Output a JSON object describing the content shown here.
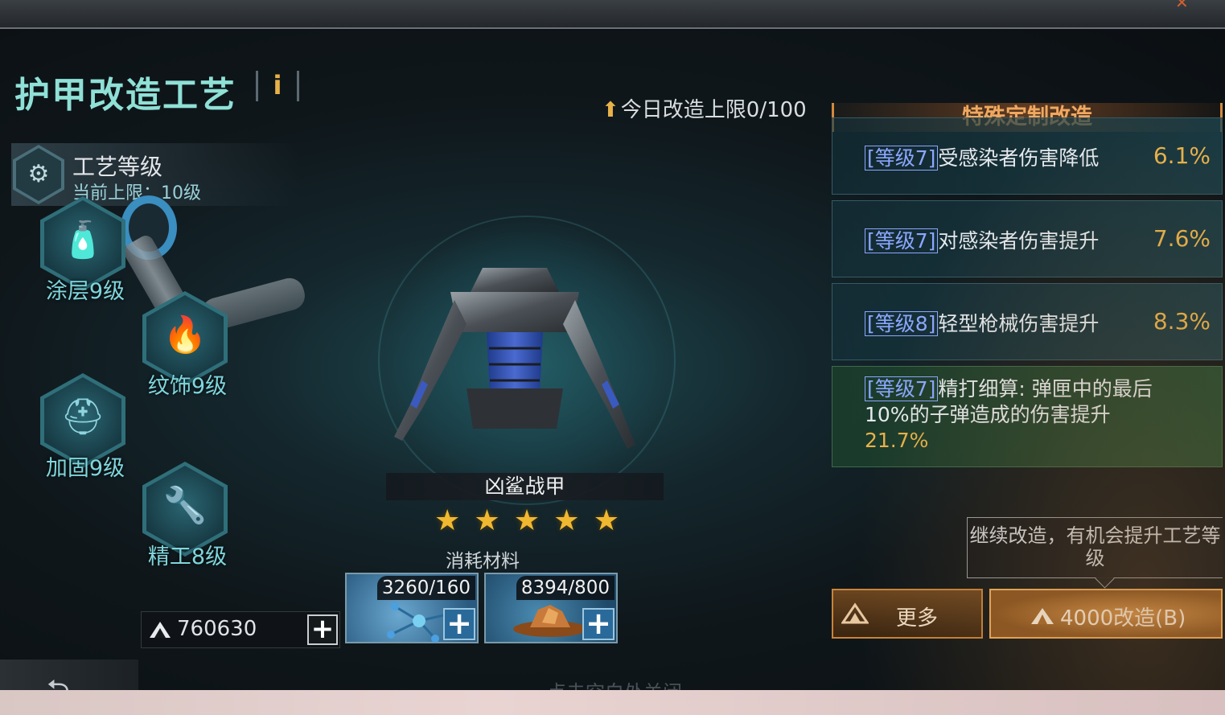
{
  "header": {
    "title": "护甲改造工艺",
    "info_label": "i",
    "daily_limit": "今日改造上限0/100"
  },
  "craft_level": {
    "title": "工艺等级",
    "subtitle": "当前上限：10级"
  },
  "skills": [
    {
      "label": "涂层9级",
      "icon": "spray-can-icon"
    },
    {
      "label": "纹饰9级",
      "icon": "flame-icon"
    },
    {
      "label": "加固9级",
      "icon": "welding-mask-icon"
    },
    {
      "label": "精工8级",
      "icon": "drill-icon"
    }
  ],
  "item": {
    "name": "凶鲨战甲",
    "stars": 5
  },
  "materials": {
    "label": "消耗材料",
    "items": [
      {
        "count": "3260/160",
        "icon": "molecule-icon"
      },
      {
        "count": "8394/800",
        "icon": "ore-icon"
      }
    ]
  },
  "currency": {
    "amount": "760630",
    "icon": "resource-icon"
  },
  "close_hint": "点击空白处关闭",
  "special": {
    "header": "特殊定制改造",
    "effects": [
      {
        "tag": "[等级7]",
        "text": "受感染者伤害降低",
        "value": "6.1%"
      },
      {
        "tag": "[等级7]",
        "text": "对感染者伤害提升",
        "value": "7.6%"
      },
      {
        "tag": "[等级8]",
        "text": "轻型枪械伤害提升",
        "value": "8.3%"
      },
      {
        "tag": "[等级7]",
        "text": "精打细算: 弹匣中的最后",
        "text2": "10%的子弹造成的伤害提升",
        "value": "21.7%"
      }
    ]
  },
  "tooltip": "继续改造，有机会提升工艺等级",
  "buttons": {
    "more": "更多",
    "modify": "4000改造(B)"
  },
  "colors": {
    "accent_gold": "#e8b24a",
    "title_teal": "#8fe0d6",
    "tag_blue": "#8aa8ff",
    "button_orange": "#c8843a"
  }
}
